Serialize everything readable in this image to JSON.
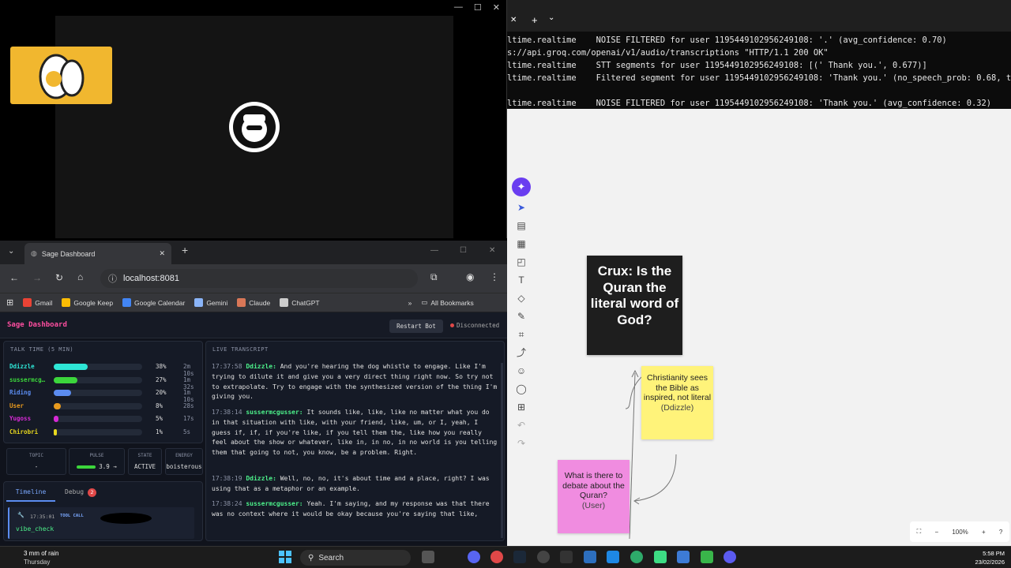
{
  "video_window": {
    "controls": [
      "—",
      "☐",
      "✕"
    ]
  },
  "terminal": {
    "tab_controls": [
      "✕",
      "+",
      "⌄"
    ],
    "lines": [
      "ltime.realtime    NOISE FILTERED for user 1195449102956249108: '.' (avg_confidence: 0.70)",
      "s://api.groq.com/openai/v1/audio/transcriptions \"HTTP/1.1 200 OK\"",
      "ltime.realtime    STT segments for user 1195449102956249108: [(' Thank you.', 0.677)]",
      "ltime.realtime    Filtered segment for user 1195449102956249108: 'Thank you.' (no_speech_prob: 0.68, thr",
      "",
      "ltime.realtime    NOISE FILTERED for user 1195449102956249108: 'Thank you.' (avg_confidence: 0.32)"
    ]
  },
  "whiteboard": {
    "crux": "Crux: Is the Quran the literal word of God?",
    "note1": {
      "text": "Christianity sees the Bible as inspired, not literal",
      "by": "(Ddizzle)"
    },
    "note2": {
      "text": "What is there to debate about the Quran?",
      "by": "(User)"
    },
    "zoom": "100%",
    "colors": {
      "crux": "#1e1e1e",
      "note1": "#fff37a",
      "note2": "#f08ce0",
      "accent": "#6a3df0"
    }
  },
  "browser": {
    "tab_title": "Sage Dashboard",
    "url": "localhost:8081",
    "bookmarks": [
      {
        "label": "Gmail",
        "color": "#ea4335"
      },
      {
        "label": "Google Keep",
        "color": "#fbbc04"
      },
      {
        "label": "Google Calendar",
        "color": "#4285f4"
      },
      {
        "label": "Gemini",
        "color": "#8ab4f8"
      },
      {
        "label": "Claude",
        "color": "#d97757"
      },
      {
        "label": "ChatGPT",
        "color": "#cccccc"
      }
    ],
    "all_bookmarks": "All Bookmarks"
  },
  "dashboard": {
    "title": "Sage Dashboard",
    "restart_label": "Restart Bot",
    "status": "Disconnected",
    "talk_time_title": "TALK TIME (5 MIN)",
    "speakers": [
      {
        "name": "Ddizzle",
        "pct": "38%",
        "time": "2m 10s",
        "share": 0.38,
        "color": "#2ee6d6"
      },
      {
        "name": "sussermcg…",
        "pct": "27%",
        "time": "1m 32s",
        "share": 0.27,
        "color": "#3cd63c"
      },
      {
        "name": "Riding",
        "pct": "20%",
        "time": "1m 10s",
        "share": 0.2,
        "color": "#5b8cf0"
      },
      {
        "name": "User",
        "pct": "8%",
        "time": "28s",
        "share": 0.08,
        "color": "#e89a1e"
      },
      {
        "name": "Yugoss",
        "pct": "5%",
        "time": "17s",
        "share": 0.05,
        "color": "#d62ad6"
      },
      {
        "name": "Chirobri",
        "pct": "1%",
        "time": "5s",
        "share": 0.01,
        "color": "#e8d81e"
      }
    ],
    "stats": {
      "topic_label": "TOPIC",
      "topic": "-",
      "pulse_label": "PULSE",
      "pulse": "3.9 →",
      "state_label": "STATE",
      "state": "ACTIVE",
      "energy_label": "ENERGY",
      "energy": "boisterous"
    },
    "tabs": {
      "timeline": "Timeline",
      "debug": "Debug",
      "debug_count": "2"
    },
    "timeline_item": {
      "time": "17:35:01",
      "type": "TOOL CALL",
      "name": "vibe_check"
    },
    "live_title": "LIVE TRANSCRIPT",
    "transcript": [
      {
        "ts": "17:37:58",
        "speaker": "Ddizzle:",
        "text": "And you're hearing the dog whistle to engage. Like I'm trying to dilute it and give you a very direct thing right now. So try not to extrapolate. Try to engage with the synthesized version of the thing I'm giving you."
      },
      {
        "ts": "17:38:14",
        "speaker": "sussermcgusser:",
        "text": "It sounds like, like, like no matter what you do in that situation with like, with your friend, like, um, or I, yeah, I guess if, if, if you're like, if you tell them the, like how you really feel about the show or whatever, like in, in no, in no world is you telling them that going to not, you know, be a problem. Right."
      },
      {
        "ts": "17:38:19",
        "speaker": "Ddizzle:",
        "text": "Well, no, no, it's about time and a place, right? I was using that as a metaphor or an example."
      },
      {
        "ts": "17:38:24",
        "speaker": "sussermcgusser:",
        "text": "Yeah. I'm saying, and my response was that there was no context where it would be okay because you're saying that like,"
      }
    ]
  },
  "taskbar": {
    "weather": "3 mm of rain",
    "weather_day": "Thursday",
    "search": "Search",
    "time": "5:58 PM",
    "date": "23/02/2026"
  }
}
